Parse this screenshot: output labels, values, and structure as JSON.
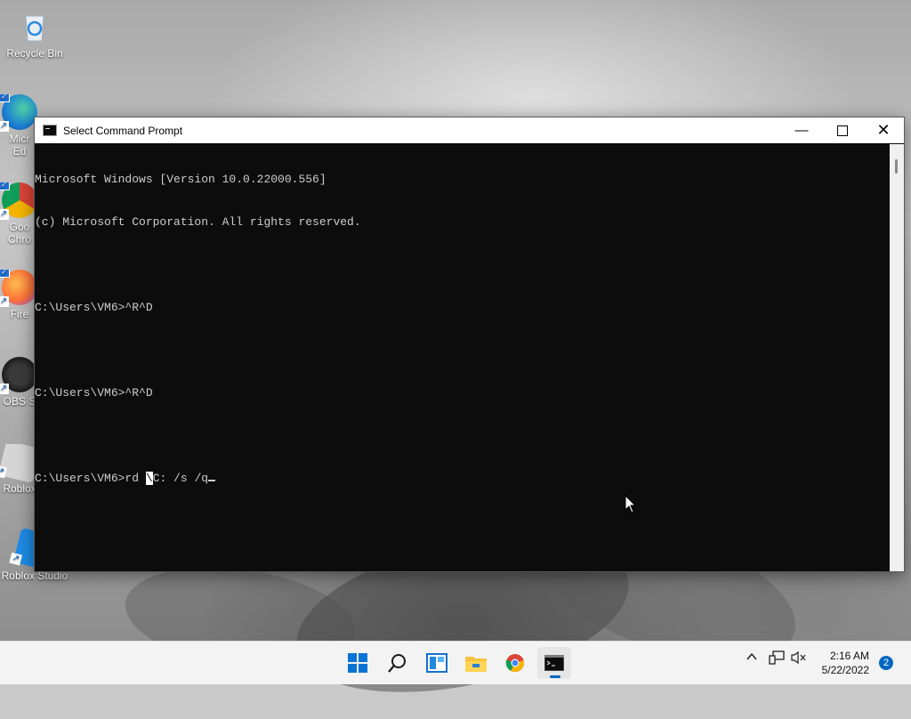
{
  "desktop": {
    "icons": [
      {
        "label": "Recycle Bin"
      },
      {
        "label": "Micr\nEd"
      },
      {
        "label": "Goo\nChro"
      },
      {
        "label": "Fire"
      },
      {
        "label": "OBS S"
      },
      {
        "label": "Roblox"
      },
      {
        "label": "Roblox Studio"
      }
    ]
  },
  "window": {
    "title": "Select Command Prompt",
    "controls": {
      "minimize": "—",
      "close": "✕"
    }
  },
  "console": {
    "lines": [
      "Microsoft Windows [Version 10.0.22000.556]",
      "(c) Microsoft Corporation. All rights reserved.",
      "",
      "C:\\Users\\VM6>^R^D",
      "",
      "C:\\Users\\VM6>^R^D",
      "",
      "C:\\Users\\VM6>rd "
    ],
    "selected_char": "\\",
    "after_selection": "C: /s /q"
  },
  "taskbar": {
    "apps": [
      {
        "icon": "windows-start-icon"
      },
      {
        "icon": "search-icon"
      },
      {
        "icon": "widgets-icon"
      },
      {
        "icon": "file-explorer-icon"
      },
      {
        "icon": "chrome-icon"
      },
      {
        "icon": "command-prompt-icon"
      }
    ],
    "time": "2:16 AM",
    "date": "5/22/2022",
    "notification_count": "2"
  },
  "colors": {
    "console_bg": "#0c0c0c",
    "console_fg": "#cccccc",
    "accent": "#0067c0"
  }
}
